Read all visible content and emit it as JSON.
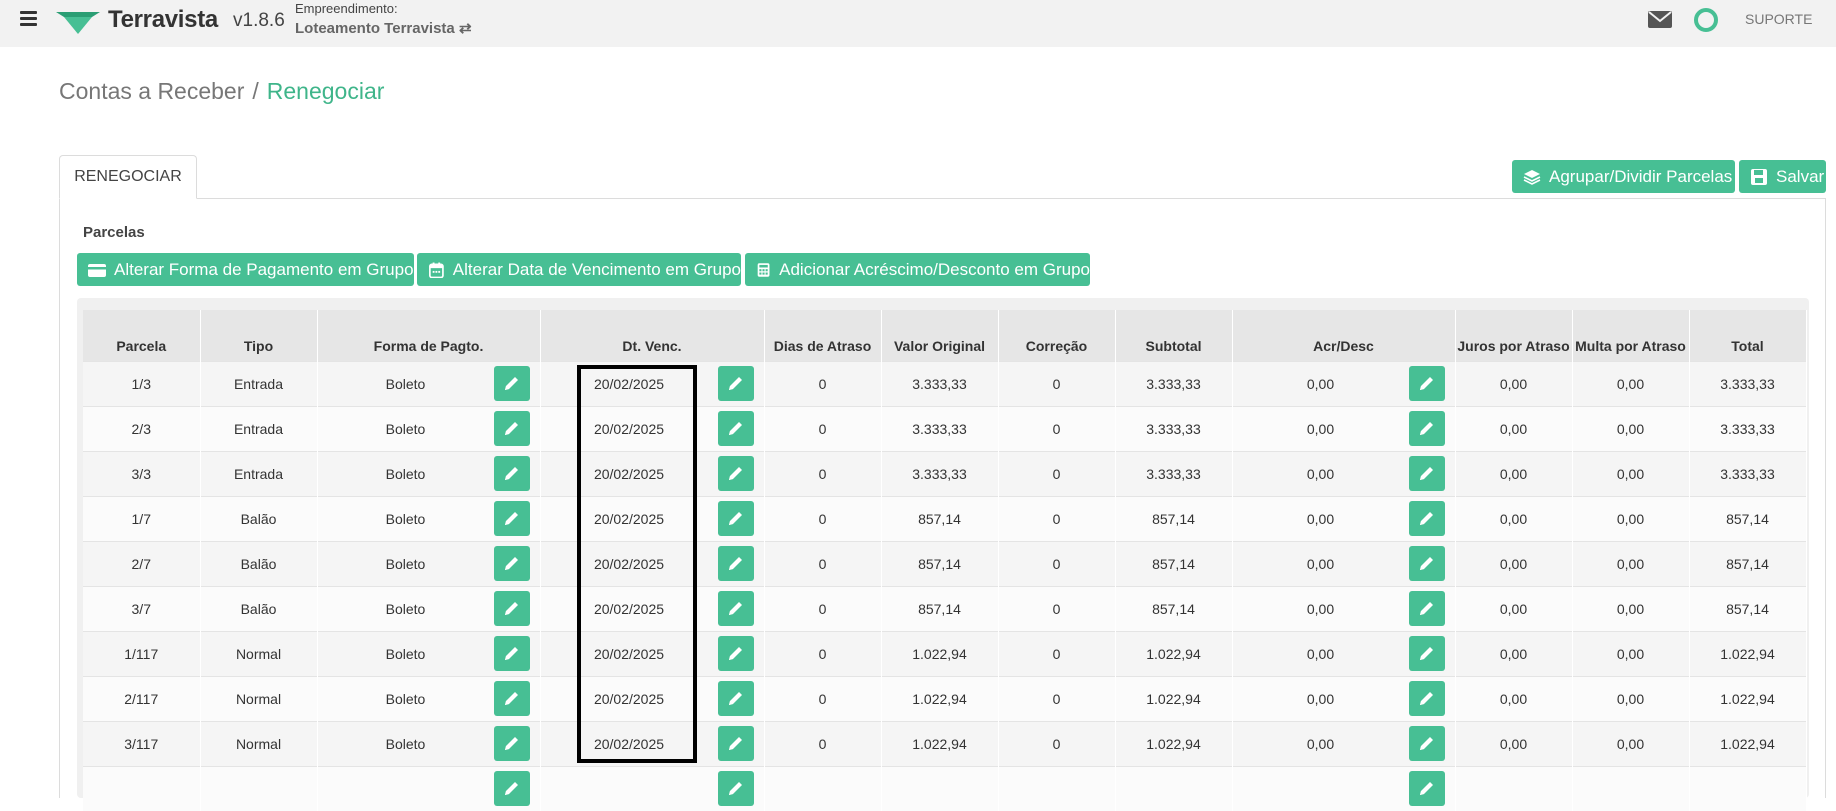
{
  "app": {
    "brand": "Terravista",
    "version": "v1.8.6",
    "emp_label": "Empreendimento:",
    "emp_name": "Loteamento Terravista ⇄",
    "support": "SUPORTE"
  },
  "breadcrumb": {
    "parent": "Contas a Receber",
    "separator": "/",
    "current": "Renegociar"
  },
  "tab": {
    "label": "RENEGOCIAR"
  },
  "actions": {
    "group_label": "Agrupar/Dividir Parcelas",
    "save_label": "Salvar"
  },
  "section": {
    "title": "Parcelas"
  },
  "group_buttons": {
    "payment": "Alterar Forma de Pagamento em Grupo",
    "due_date": "Alterar Data de Vencimento em Grupo",
    "adjust": "Adicionar Acréscimo/Desconto em Grupo"
  },
  "table": {
    "headers": {
      "parcela": "Parcela",
      "tipo": "Tipo",
      "forma": "Forma de Pagto.",
      "venc": "Dt. Venc.",
      "dias": "Dias de Atraso",
      "valor": "Valor Original",
      "correcao": "Correção",
      "subtotal": "Subtotal",
      "acr": "Acr/Desc",
      "juros": "Juros por Atraso",
      "multa": "Multa por Atraso",
      "total": "Total"
    },
    "rows": [
      {
        "parcela": "1/3",
        "tipo": "Entrada",
        "forma": "Boleto",
        "venc": "20/02/2025",
        "dias": "0",
        "valor": "3.333,33",
        "correcao": "0",
        "subtotal": "3.333,33",
        "acr": "0,00",
        "juros": "0,00",
        "multa": "0,00",
        "total": "3.333,33"
      },
      {
        "parcela": "2/3",
        "tipo": "Entrada",
        "forma": "Boleto",
        "venc": "20/02/2025",
        "dias": "0",
        "valor": "3.333,33",
        "correcao": "0",
        "subtotal": "3.333,33",
        "acr": "0,00",
        "juros": "0,00",
        "multa": "0,00",
        "total": "3.333,33"
      },
      {
        "parcela": "3/3",
        "tipo": "Entrada",
        "forma": "Boleto",
        "venc": "20/02/2025",
        "dias": "0",
        "valor": "3.333,33",
        "correcao": "0",
        "subtotal": "3.333,33",
        "acr": "0,00",
        "juros": "0,00",
        "multa": "0,00",
        "total": "3.333,33"
      },
      {
        "parcela": "1/7",
        "tipo": "Balão",
        "forma": "Boleto",
        "venc": "20/02/2025",
        "dias": "0",
        "valor": "857,14",
        "correcao": "0",
        "subtotal": "857,14",
        "acr": "0,00",
        "juros": "0,00",
        "multa": "0,00",
        "total": "857,14"
      },
      {
        "parcela": "2/7",
        "tipo": "Balão",
        "forma": "Boleto",
        "venc": "20/02/2025",
        "dias": "0",
        "valor": "857,14",
        "correcao": "0",
        "subtotal": "857,14",
        "acr": "0,00",
        "juros": "0,00",
        "multa": "0,00",
        "total": "857,14"
      },
      {
        "parcela": "3/7",
        "tipo": "Balão",
        "forma": "Boleto",
        "venc": "20/02/2025",
        "dias": "0",
        "valor": "857,14",
        "correcao": "0",
        "subtotal": "857,14",
        "acr": "0,00",
        "juros": "0,00",
        "multa": "0,00",
        "total": "857,14"
      },
      {
        "parcela": "1/117",
        "tipo": "Normal",
        "forma": "Boleto",
        "venc": "20/02/2025",
        "dias": "0",
        "valor": "1.022,94",
        "correcao": "0",
        "subtotal": "1.022,94",
        "acr": "0,00",
        "juros": "0,00",
        "multa": "0,00",
        "total": "1.022,94"
      },
      {
        "parcela": "2/117",
        "tipo": "Normal",
        "forma": "Boleto",
        "venc": "20/02/2025",
        "dias": "0",
        "valor": "1.022,94",
        "correcao": "0",
        "subtotal": "1.022,94",
        "acr": "0,00",
        "juros": "0,00",
        "multa": "0,00",
        "total": "1.022,94"
      },
      {
        "parcela": "3/117",
        "tipo": "Normal",
        "forma": "Boleto",
        "venc": "20/02/2025",
        "dias": "0",
        "valor": "1.022,94",
        "correcao": "0",
        "subtotal": "1.022,94",
        "acr": "0,00",
        "juros": "0,00",
        "multa": "0,00",
        "total": "1.022,94"
      },
      {
        "parcela": "",
        "tipo": "",
        "forma": "",
        "venc": "",
        "dias": "",
        "valor": "",
        "correcao": "",
        "subtotal": "",
        "acr": "",
        "juros": "",
        "multa": "",
        "total": ""
      }
    ]
  },
  "colors": {
    "accent": "#47bf94",
    "breadcrumb_active": "#3fb58a"
  }
}
